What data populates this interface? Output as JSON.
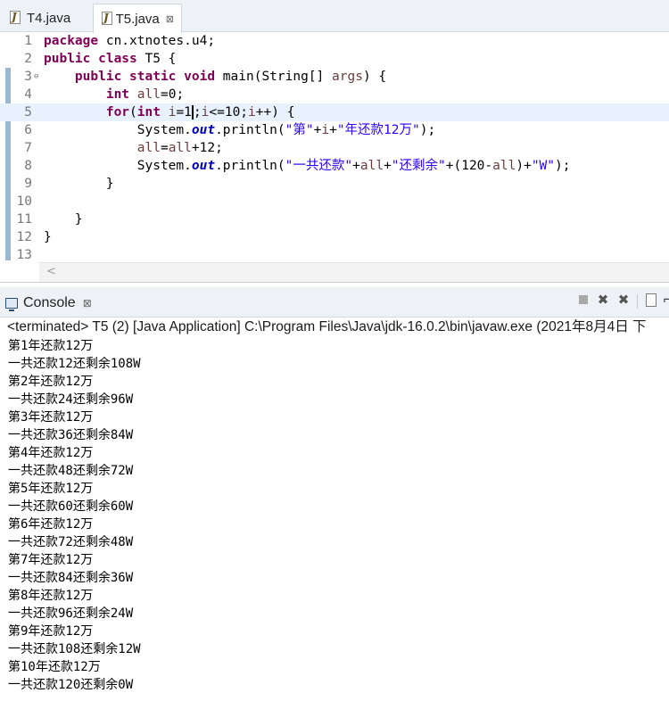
{
  "editor": {
    "tabs": [
      {
        "label": "T4.java",
        "active": false
      },
      {
        "label": "T5.java",
        "active": true,
        "close": "⊠"
      }
    ],
    "lines": [
      {
        "num": "1",
        "fold": "",
        "tokens": [
          {
            "t": "kw",
            "v": "package"
          },
          {
            "t": "p",
            "v": " cn.xtnotes.u4;"
          }
        ]
      },
      {
        "num": "2",
        "fold": "",
        "tokens": [
          {
            "t": "kw",
            "v": "public class"
          },
          {
            "t": "p",
            "v": " T5 {"
          }
        ]
      },
      {
        "num": "3",
        "fold": "⊖",
        "tokens": [
          {
            "t": "p",
            "v": "    "
          },
          {
            "t": "kw",
            "v": "public static void"
          },
          {
            "t": "p",
            "v": " main(String[] "
          },
          {
            "t": "var",
            "v": "args"
          },
          {
            "t": "p",
            "v": ") {"
          }
        ]
      },
      {
        "num": "4",
        "fold": "",
        "tokens": [
          {
            "t": "p",
            "v": "        "
          },
          {
            "t": "kw",
            "v": "int"
          },
          {
            "t": "p",
            "v": " "
          },
          {
            "t": "var",
            "v": "all"
          },
          {
            "t": "p",
            "v": "=0;"
          }
        ]
      },
      {
        "num": "5",
        "fold": "",
        "current": true,
        "tokens": [
          {
            "t": "p",
            "v": "        "
          },
          {
            "t": "kw",
            "v": "for"
          },
          {
            "t": "p",
            "v": "("
          },
          {
            "t": "kw",
            "v": "int"
          },
          {
            "t": "p",
            "v": " "
          },
          {
            "t": "var",
            "v": "i"
          },
          {
            "t": "p",
            "v": "=1"
          },
          {
            "t": "caret",
            "v": ""
          },
          {
            "t": "p",
            "v": ";"
          },
          {
            "t": "var",
            "v": "i"
          },
          {
            "t": "p",
            "v": "<=10;"
          },
          {
            "t": "var",
            "v": "i"
          },
          {
            "t": "p",
            "v": "++) {"
          }
        ]
      },
      {
        "num": "6",
        "fold": "",
        "tokens": [
          {
            "t": "p",
            "v": "            System."
          },
          {
            "t": "fld",
            "v": "out"
          },
          {
            "t": "p",
            "v": ".println("
          },
          {
            "t": "str",
            "v": "\"第\""
          },
          {
            "t": "p",
            "v": "+"
          },
          {
            "t": "var",
            "v": "i"
          },
          {
            "t": "p",
            "v": "+"
          },
          {
            "t": "str",
            "v": "\"年还款12万\""
          },
          {
            "t": "p",
            "v": ");"
          }
        ]
      },
      {
        "num": "7",
        "fold": "",
        "tokens": [
          {
            "t": "p",
            "v": "            "
          },
          {
            "t": "var",
            "v": "all"
          },
          {
            "t": "p",
            "v": "="
          },
          {
            "t": "var",
            "v": "all"
          },
          {
            "t": "p",
            "v": "+12;"
          }
        ]
      },
      {
        "num": "8",
        "fold": "",
        "tokens": [
          {
            "t": "p",
            "v": "            System."
          },
          {
            "t": "fld",
            "v": "out"
          },
          {
            "t": "p",
            "v": ".println("
          },
          {
            "t": "str",
            "v": "\"一共还款\""
          },
          {
            "t": "p",
            "v": "+"
          },
          {
            "t": "var",
            "v": "all"
          },
          {
            "t": "p",
            "v": "+"
          },
          {
            "t": "str",
            "v": "\"还剩余\""
          },
          {
            "t": "p",
            "v": "+(120-"
          },
          {
            "t": "var",
            "v": "all"
          },
          {
            "t": "p",
            "v": ")+"
          },
          {
            "t": "str",
            "v": "\"W\""
          },
          {
            "t": "p",
            "v": ");"
          }
        ]
      },
      {
        "num": "9",
        "fold": "",
        "tokens": [
          {
            "t": "p",
            "v": "        }"
          }
        ]
      },
      {
        "num": "10",
        "fold": "",
        "tokens": []
      },
      {
        "num": "11",
        "fold": "",
        "tokens": [
          {
            "t": "p",
            "v": "    }"
          }
        ]
      },
      {
        "num": "12",
        "fold": "",
        "tokens": [
          {
            "t": "p",
            "v": "}"
          }
        ]
      },
      {
        "num": "13",
        "fold": "",
        "tokens": []
      }
    ],
    "scroll_arrow": "<"
  },
  "console": {
    "tab_label": "Console",
    "tab_close": "⊠",
    "status": "<terminated> T5 (2) [Java Application] C:\\Program Files\\Java\\jdk-16.0.2\\bin\\javaw.exe (2021年8月4日 下",
    "tools": {
      "remove": "✖",
      "removeall": "✖",
      "more": "⌐"
    },
    "output": [
      "第1年还款12万",
      "一共还款12还剩余108W",
      "第2年还款12万",
      "一共还款24还剩余96W",
      "第3年还款12万",
      "一共还款36还剩余84W",
      "第4年还款12万",
      "一共还款48还剩余72W",
      "第5年还款12万",
      "一共还款60还剩余60W",
      "第6年还款12万",
      "一共还款72还剩余48W",
      "第7年还款12万",
      "一共还款84还剩余36W",
      "第8年还款12万",
      "一共还款96还剩余24W",
      "第9年还款12万",
      "一共还款108还剩余12W",
      "第10年还款12万",
      "一共还款120还剩余0W"
    ]
  }
}
